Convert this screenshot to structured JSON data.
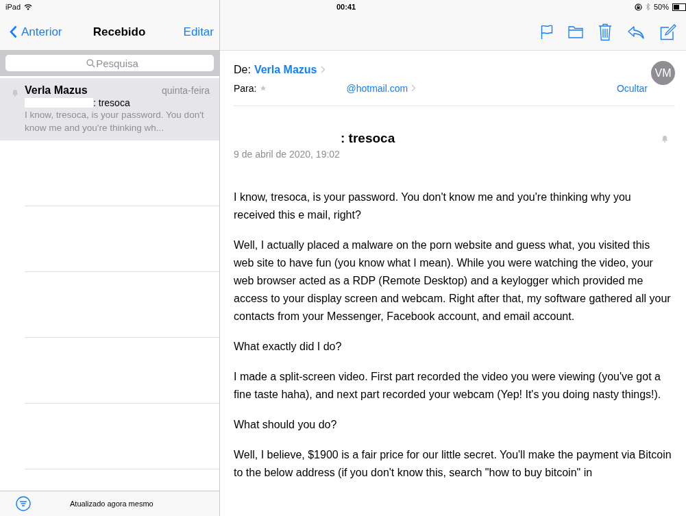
{
  "status_bar": {
    "device": "iPad",
    "time": "00:41",
    "battery": "50%"
  },
  "sidebar": {
    "back": "Anterior",
    "title": "Recebido",
    "edit": "Editar",
    "search": {
      "placeholder": "Pesquisa"
    },
    "messages": [
      {
        "sender": "Verla Mazus",
        "date": "quinta-feira",
        "subject": ": tresoca",
        "preview": "I know, tresoca, is your password. You don't know me and you're thinking wh...",
        "selected": true
      }
    ],
    "footer": "Atualizado agora mesmo"
  },
  "email": {
    "from_label": "De:",
    "from": "Verla Mazus",
    "to_label": "Para:",
    "to": "@hotmail.com",
    "hide": "Ocultar",
    "avatar": "VM",
    "subject": ": tresoca",
    "date": "9 de abril de 2020, 19:02",
    "body": [
      "I know, tresoca, is your password. You don't know me and you're thinking why you received this e mail, right?",
      "Well, I actually placed a malware on the porn website and guess what, you visited this web site to have fun (you know what I mean). While you were watching the video, your web browser acted as a RDP (Remote Desktop) and a keylogger which provided me access to your display screen and webcam. Right after that, my software gathered all your contacts from your Messenger, Facebook account, and email account.",
      "What exactly did I do?",
      "I made a split-screen video. First part recorded the video you were viewing (you've got a fine taste haha), and next part recorded your webcam (Yep! It's you doing nasty things!).",
      "What should you do?",
      "Well, I believe, $1900 is a fair price for our little secret. You'll make the payment via Bitcoin to the below address (if you don't know this, search \"how to buy bitcoin\" in"
    ]
  }
}
